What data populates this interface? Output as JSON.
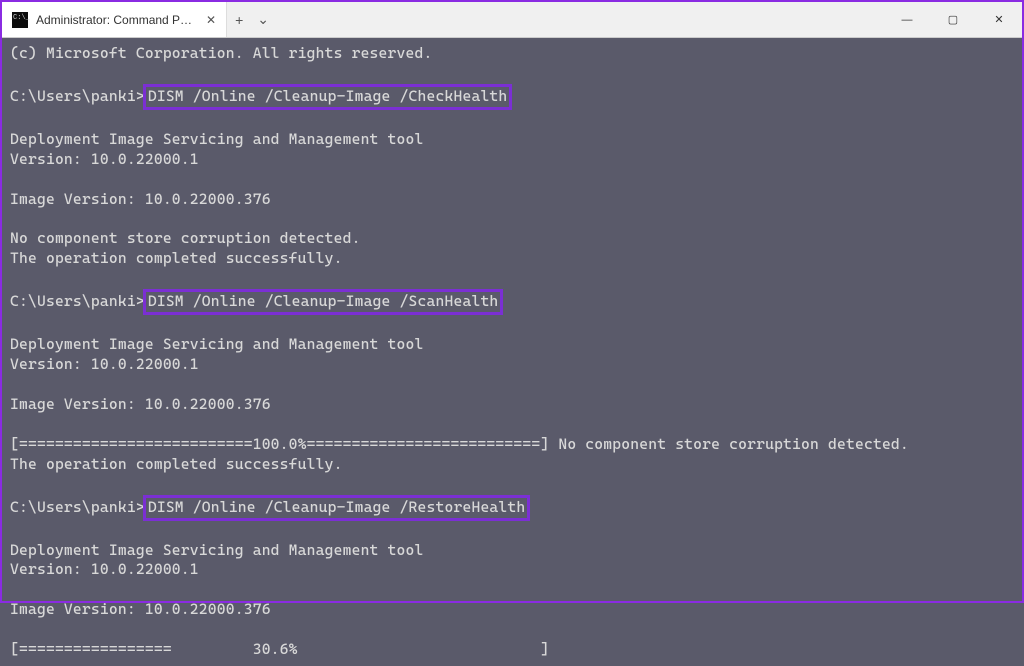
{
  "titlebar": {
    "tab_title": "Administrator: Command Promp",
    "close_glyph": "✕",
    "plus_glyph": "+",
    "chevron_glyph": "⌄",
    "min_glyph": "—",
    "max_glyph": "▢",
    "win_close_glyph": "✕"
  },
  "terminal": {
    "copyright": "(c) Microsoft Corporation. All rights reserved.",
    "prompt": "C:\\Users\\panki>",
    "cmd1": "DISM /Online /Cleanup-Image /CheckHealth",
    "cmd2": "DISM /Online /Cleanup-Image /ScanHealth",
    "cmd3": "DISM /Online /Cleanup-Image /RestoreHealth",
    "tool_line": "Deployment Image Servicing and Management tool",
    "version_line": "Version: 10.0.22000.1",
    "image_version": "Image Version: 10.0.22000.376",
    "no_corruption": "No component store corruption detected.",
    "op_success": "The operation completed successfully.",
    "progress100": "[==========================100.0%==========================] No component store corruption detected.",
    "progress30": "[=================         30.6%                           ]"
  }
}
